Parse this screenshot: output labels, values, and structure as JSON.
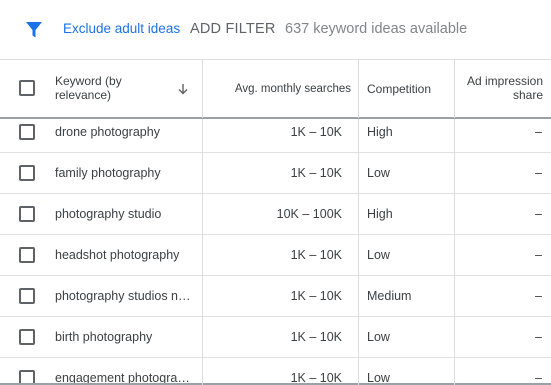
{
  "toolbar": {
    "filter_icon": "filter-icon",
    "exclude_label": "Exclude adult ideas",
    "add_filter_label": "ADD FILTER",
    "ideas_count": "637 keyword ideas available"
  },
  "table": {
    "headers": {
      "keyword": "Keyword (by relevance)",
      "sort_icon": "arrow-down-icon",
      "avg_monthly": "Avg. monthly searches",
      "competition": "Competition",
      "ad_impression": "Ad impression share"
    },
    "rows": [
      {
        "keyword": "drone photography",
        "avg": "1K – 10K",
        "competition": "High",
        "ad_share": "–"
      },
      {
        "keyword": "family photography",
        "avg": "1K – 10K",
        "competition": "Low",
        "ad_share": "–"
      },
      {
        "keyword": "photography studio",
        "avg": "10K – 100K",
        "competition": "High",
        "ad_share": "–"
      },
      {
        "keyword": "headshot photography",
        "avg": "1K – 10K",
        "competition": "Low",
        "ad_share": "–"
      },
      {
        "keyword": "photography studios ne...",
        "avg": "1K – 10K",
        "competition": "Medium",
        "ad_share": "–"
      },
      {
        "keyword": "birth photography",
        "avg": "1K – 10K",
        "competition": "Low",
        "ad_share": "–"
      },
      {
        "keyword": "engagement photography",
        "avg": "1K – 10K",
        "competition": "Low",
        "ad_share": "–"
      }
    ]
  },
  "colors": {
    "accent": "#1a73e8",
    "text": "#3c4043",
    "muted": "#80868b",
    "border": "#dadce0"
  }
}
